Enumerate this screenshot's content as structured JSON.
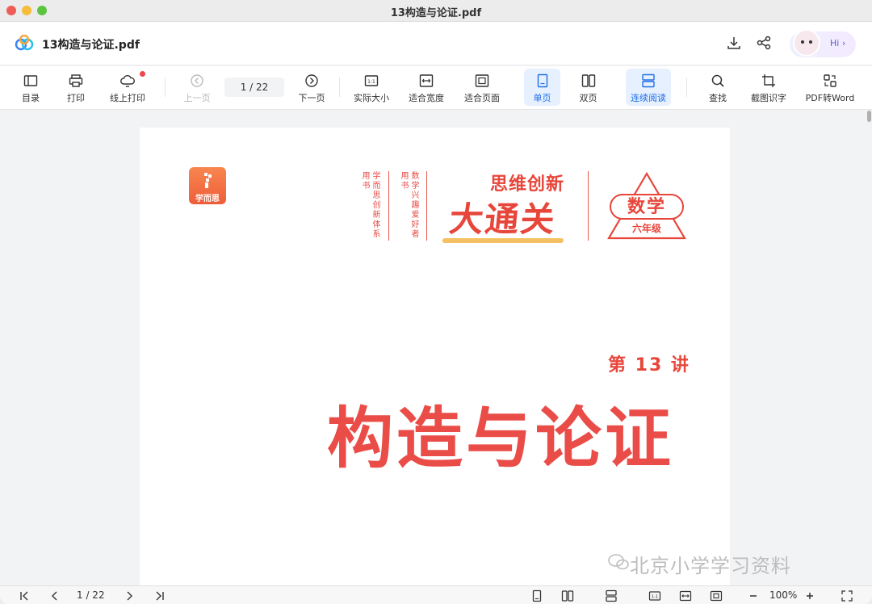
{
  "window": {
    "title": "13构造与论证.pdf"
  },
  "header": {
    "doc_title": "13构造与论证.pdf",
    "assistant_label": "Hi"
  },
  "toolbar": {
    "catalog": "目录",
    "print": "打印",
    "online_print": "线上打印",
    "prev_page": "上一页",
    "page_indicator": "1  /  22",
    "next_page": "下一页",
    "actual_size": "实际大小",
    "fit_width": "适合宽度",
    "fit_page": "适合页面",
    "single_page": "单页",
    "double_page": "双页",
    "continuous": "连续阅读",
    "search": "查找",
    "ocr": "截图识字",
    "pdf_to_word": "PDF转Word"
  },
  "document": {
    "brand_logo_text": "学而思",
    "tagline_1": "学而思创新体系用书",
    "tagline_2": "数学兴趣爱好者用书",
    "series_subtitle": "思维创新",
    "series_title": "大通关",
    "subject": "数学",
    "grade": "六年级",
    "lecture_number": "第 13 讲",
    "lecture_title": "构造与论证",
    "watermark": "北京小学学习资料"
  },
  "bottombar": {
    "page_indicator": "1  /  22",
    "zoom": "100%"
  },
  "colors": {
    "accent": "#1f6fe6",
    "brand_red": "#e7463b",
    "brand_orange": "#f2b03a"
  }
}
